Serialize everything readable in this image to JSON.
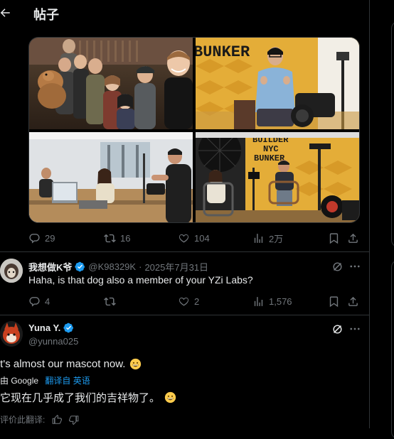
{
  "header": {
    "title": "帖子"
  },
  "main_tweet": {
    "metrics": {
      "replies": "29",
      "reposts": "16",
      "likes": "104",
      "views": "2万"
    },
    "photos": {
      "p2_sign": "BUNKER",
      "p4_sign_line1": "BUILDER",
      "p4_sign_line2": "NYC",
      "p4_sign_line3": "BUNKER"
    }
  },
  "reply": {
    "display_name": "我想做K爷",
    "handle": "@K98329K",
    "separator": "·",
    "date": "2025年7月31日",
    "text": "Haha, is that dog also a member of your YZi Labs?",
    "metrics": {
      "replies": "4",
      "reposts": "",
      "likes": "2",
      "views": "1,576"
    }
  },
  "yuna": {
    "display_name": "Yuna Y.",
    "handle": "@yunna025",
    "text": "It's almost our mascot now.",
    "by_label": "由 Google",
    "translate_label": "翻译自 英语",
    "translated_text": "它现在几乎成了我们的吉祥物了。",
    "rate_label": "评价此翻译:"
  },
  "colors": {
    "accent": "#1d9bf0",
    "muted": "#71767b",
    "text": "#e7e9ea",
    "border": "#2f3336",
    "background": "#000000"
  }
}
